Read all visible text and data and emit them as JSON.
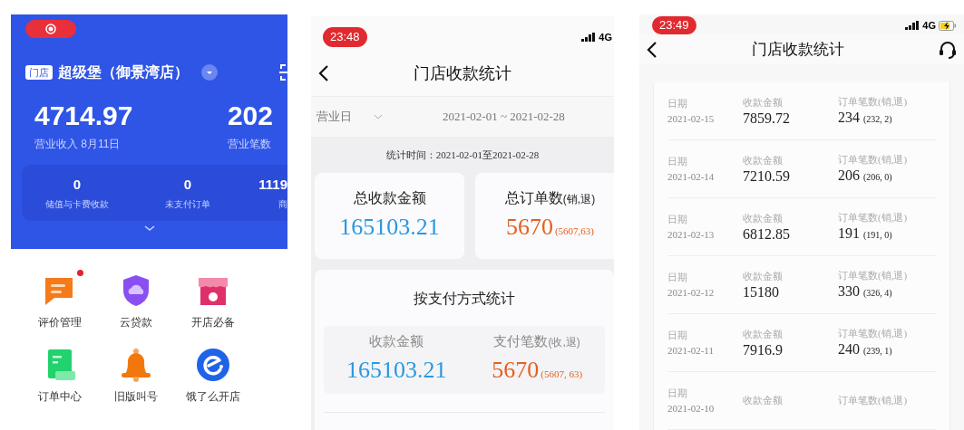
{
  "home_screen": {
    "store_badge": "门店",
    "store_name": "超级堡（御景湾店）",
    "main_stats": [
      {
        "value": "4714.97",
        "label": "营业收入 8月11日"
      },
      {
        "value": "202",
        "label": "营业笔数"
      }
    ],
    "sub_stats": [
      {
        "value": "0",
        "label": "储值与卡费收款"
      },
      {
        "value": "0",
        "label": "未支付订单"
      },
      {
        "value": "1119",
        "label": "商"
      }
    ],
    "shortcuts": [
      {
        "kind": "review",
        "label": "评价管理",
        "badge": true
      },
      {
        "kind": "loan",
        "label": "云贷款",
        "badge": false
      },
      {
        "kind": "shop",
        "label": "开店必备",
        "badge": false
      },
      {
        "kind": "orders",
        "label": "订单中心",
        "badge": false
      },
      {
        "kind": "bell",
        "label": "旧版叫号",
        "badge": false
      },
      {
        "kind": "eleme",
        "label": "饿了么开店",
        "badge": false
      }
    ]
  },
  "summary_screen": {
    "time": "23:48",
    "network": "4G",
    "title": "门店收款统计",
    "filter": "营业日",
    "date_range": "2021-02-01 ~ 2021-02-28",
    "stat_time": "统计时间：2021-02-01至2021-02-28",
    "totals": [
      {
        "kind": "amount",
        "label": "总收款金额",
        "value": "165103.21"
      },
      {
        "kind": "count",
        "label": "总订单数",
        "label_note": "(销,退)",
        "value": "5670",
        "value_note": "(5607,63)"
      }
    ],
    "by_payment": {
      "title": "按支付方式统计",
      "items": [
        {
          "kind": "amount",
          "label": "收款金额",
          "value": "165103.21"
        },
        {
          "kind": "count",
          "label": "支付笔数",
          "label_note": "(收,退)",
          "value": "5670",
          "value_note": "(5607, 63)"
        }
      ]
    }
  },
  "daily_screen": {
    "time": "23:49",
    "network": "4G",
    "title": "门店收款统计",
    "rows": [
      {
        "date_label": "日期",
        "date": "2021-02-15",
        "amount_label": "收款金额",
        "amount": "7859.72",
        "count_label": "订单笔数(销,退)",
        "count": "234",
        "count_note": "(232, 2)"
      },
      {
        "date_label": "日期",
        "date": "2021-02-14",
        "amount_label": "收款金额",
        "amount": "7210.59",
        "count_label": "订单笔数(销,退)",
        "count": "206",
        "count_note": "(206, 0)"
      },
      {
        "date_label": "日期",
        "date": "2021-02-13",
        "amount_label": "收款金额",
        "amount": "6812.85",
        "count_label": "订单笔数(销,退)",
        "count": "191",
        "count_note": "(191, 0)"
      },
      {
        "date_label": "日期",
        "date": "2021-02-12",
        "amount_label": "收款金额",
        "amount": "15180",
        "count_label": "订单笔数(销,退)",
        "count": "330",
        "count_note": "(326, 4)"
      },
      {
        "date_label": "日期",
        "date": "2021-02-11",
        "amount_label": "收款金额",
        "amount": "7916.9",
        "count_label": "订单笔数(销,退)",
        "count": "240",
        "count_note": "(239, 1)"
      },
      {
        "date_label": "日期",
        "date": "2021-02-10",
        "amount_label": "收款金额",
        "count_label": "订单笔数(销,退)"
      }
    ]
  }
}
